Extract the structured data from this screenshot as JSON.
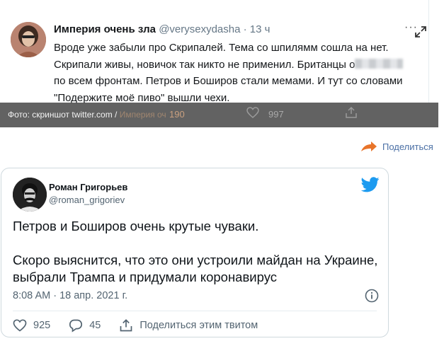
{
  "screenshot": {
    "author_name": "Империя очень зла",
    "author_handle": "@verysexydasha",
    "time": "· 13 ч",
    "more": "···",
    "text_line1": "Вроде уже забыли про Скрипалей. Тема со шпилямм сошла на нет.",
    "text_line2_a": "Скрипали живы, новичок так никто не применил. Британцы о",
    "text_line3": "по всем фронтам. Петров и Боширов стали мемами. И тут со словами",
    "text_line4": "\"Подержите моё пиво\" вышли чехи.",
    "photo_credit": "Фото: скриншот twitter.com /",
    "photo_credit_blurred": "Империя оч",
    "count_retweets": "190",
    "count_likes": "997"
  },
  "share": {
    "label": "Поделиться",
    "accent": "#e8742a"
  },
  "embed": {
    "author_name": "Роман Григорьев",
    "author_handle": "@roman_grigoriev",
    "text_p1": "Петров и Боширов очень крутые чуваки.",
    "text_p2": "Скоро выяснится, что это они устроили майдан на Украине, выбрали Трампа и придумали коронавирус",
    "timestamp": "8:08 AM · 18 апр. 2021 г.",
    "likes": "925",
    "replies": "45",
    "share_label": "Поделиться этим твитом",
    "twitter_blue": "#1d9bf0"
  }
}
